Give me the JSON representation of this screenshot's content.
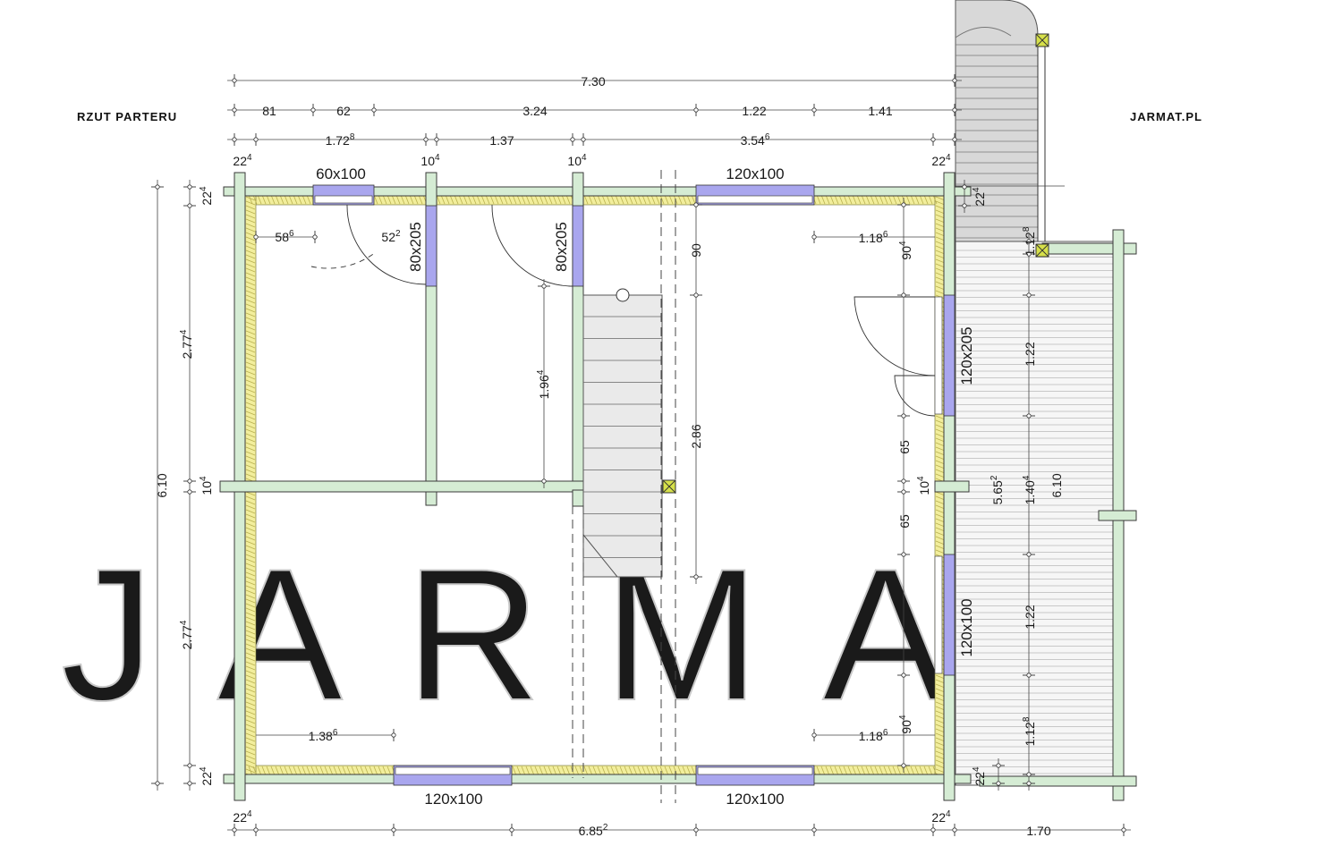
{
  "header": {
    "title_left": "RZUT PARTERU",
    "title_right": "JARMAT.PL"
  },
  "watermark": "JARMAT",
  "colors": {
    "wall": "#d5ecd4",
    "wall_stroke": "#3a3a3a",
    "insulation": "#f2ee9c",
    "opening": "#a9a6ee",
    "post": "#d6e04a",
    "stair": "#e6e6e6",
    "terrace": "#ececec"
  },
  "dimensions": {
    "total_top": "7.30",
    "top_row": [
      "81",
      "62",
      "3.24",
      "1.22",
      "1.41"
    ],
    "mid_row": [
      {
        "base": "1.72",
        "sup": "8"
      },
      {
        "base": "1.37",
        "sup": ""
      },
      {
        "base": "3.54",
        "sup": "6"
      }
    ],
    "wall_marks_top": [
      {
        "base": "22",
        "sup": "4"
      },
      {
        "base": "10",
        "sup": "4"
      },
      {
        "base": "10",
        "sup": "4"
      },
      {
        "base": "22",
        "sup": "4"
      }
    ],
    "bottom_marks": [
      {
        "base": "22",
        "sup": "4"
      },
      {
        "base": "22",
        "sup": "4"
      }
    ],
    "bottom_total": {
      "base": "6.85",
      "sup": "2"
    },
    "bottom_terrace": "1.70",
    "left_total": "6.10",
    "left_parts": [
      {
        "base": "22",
        "sup": "4"
      },
      {
        "base": "2.77",
        "sup": "4"
      },
      {
        "base": "10",
        "sup": "4"
      },
      {
        "base": "2.77",
        "sup": "4"
      },
      {
        "base": "22",
        "sup": "4"
      }
    ],
    "inner": {
      "d586": {
        "base": "58",
        "sup": "6"
      },
      "d522": {
        "base": "52",
        "sup": "2"
      },
      "d1186_top": {
        "base": "1.18",
        "sup": "6"
      },
      "d904_top": {
        "base": "90",
        "sup": "4"
      },
      "d90": "90",
      "d1964": {
        "base": "1.96",
        "sup": "4"
      },
      "d286": "2.86",
      "d65_a": "65",
      "d104_right": {
        "base": "10",
        "sup": "4"
      },
      "d65_b": "65",
      "d1386": {
        "base": "1.38",
        "sup": "6"
      },
      "d1186_bottom": {
        "base": "1.18",
        "sup": "6"
      },
      "d904_bottom": {
        "base": "90",
        "sup": "4"
      }
    },
    "terrace": {
      "d224_top": {
        "base": "22",
        "sup": "4"
      },
      "d1128_top": {
        "base": "1.12",
        "sup": "8"
      },
      "d122_a": "1.22",
      "d5652": {
        "base": "5.65",
        "sup": "2"
      },
      "d1404": {
        "base": "1.40",
        "sup": "4"
      },
      "d610": "6.10",
      "d122_b": "1.22",
      "d1128_bottom": {
        "base": "1.12",
        "sup": "8"
      },
      "d224_bottom": {
        "base": "22",
        "sup": "4"
      }
    }
  },
  "openings": {
    "win_top_left": "60x100",
    "win_top_right": "120x100",
    "door_a": "80x205",
    "door_b": "80x205",
    "door_entry": "120x205",
    "win_right": "120x100",
    "win_bottom_left": "120x100",
    "win_bottom_right": "120x100"
  }
}
